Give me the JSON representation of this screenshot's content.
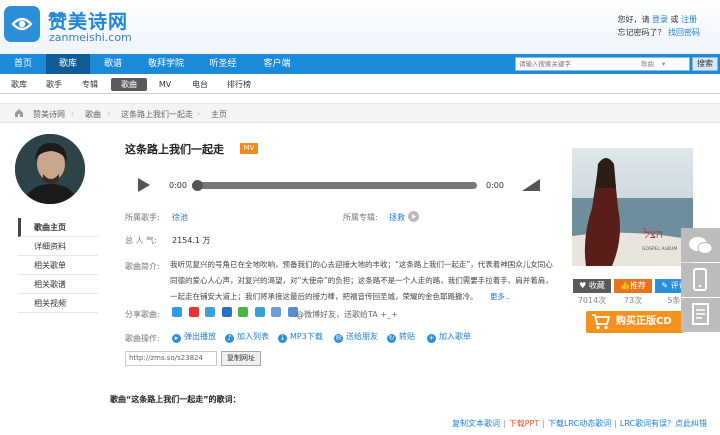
{
  "site": {
    "name": "赞美诗网",
    "domain": "zanmeishi.com"
  },
  "login": {
    "greeting": "您好，请",
    "login_link": "登录",
    "or": "或",
    "register_link": "注册",
    "forgot": "忘记密码了？",
    "retrieve_link": "找回密码"
  },
  "nav": {
    "items": [
      "首页",
      "歌库",
      "歌谱",
      "敬拜学院",
      "听圣经",
      "客户端"
    ],
    "active": "歌库"
  },
  "search": {
    "placeholder": "请输入搜索关键字",
    "scope": "歌曲",
    "button": "搜索"
  },
  "subnav": {
    "items": [
      "歌库",
      "歌手",
      "专辑",
      "歌曲",
      "MV",
      "电台",
      "排行榜"
    ],
    "active": "歌曲"
  },
  "breadcrumb": [
    "赞美诗网",
    "歌曲",
    "这条路上我们一起走",
    "主页"
  ],
  "side_menu": [
    "歌曲主页",
    "详细资料",
    "相关歌单",
    "相关歌谱",
    "相关视频"
  ],
  "song": {
    "title": "这条路上我们一起走",
    "badge": "MV",
    "time_current": "0:00",
    "time_total": "0:00",
    "progress": 0
  },
  "info": {
    "singer_label": "所属歌手:",
    "singer": "徐池",
    "album_label": "所属专辑:",
    "album": "拯救",
    "popularity_label": "总 人 气:",
    "popularity": "2154.1 万",
    "intro_label": "歌曲简介:",
    "intro": "我听见复兴的号角已在全地吹响，预备我们的心去迎接大地的丰收；“这条路上我们一起走”，代表着神国众儿女同心同德的爱心人心声，对复兴的渴望，对“大使命”的负担；这条路不是一个人走的路，我们需要手拉着手、肩并着肩，一起走在铺安大道上；我们将承接这最后的接力棒，把福音传回圣城，荣耀的金色耶路撒冷。",
    "more": "更多..",
    "share_label": "分享歌曲:",
    "share_text": "@微博好友，送歌给TA +_+",
    "ops_label": "歌曲操作:",
    "ops": [
      "弹出播放",
      "加入列表",
      "MP3下载",
      "送给朋友",
      "转贴",
      "加入歌单"
    ],
    "url": "http://zms.so/s23824",
    "copy_button": "复制网址"
  },
  "stats": {
    "fav_label": "收藏",
    "rec_label": "推荐",
    "comment_label": "评论",
    "fav_count": "7014次",
    "rec_count": "73次",
    "comment_count": "5条"
  },
  "buy_button": "购买正版CD",
  "album_cover_caption": "GOSPEL ALBUM",
  "lyrics_title": "歌曲“这条路上我们一起走”的歌词：",
  "bottom_links": [
    "复制文本歌词",
    "下载PPT",
    "下载LRC动态歌词",
    "LRC歌词有误？点此纠错"
  ],
  "colors": {
    "brand_blue": "#1b8ad9",
    "nav_active": "#0f5c96",
    "orange": "#f4921f",
    "link": "#1f7fd0"
  }
}
